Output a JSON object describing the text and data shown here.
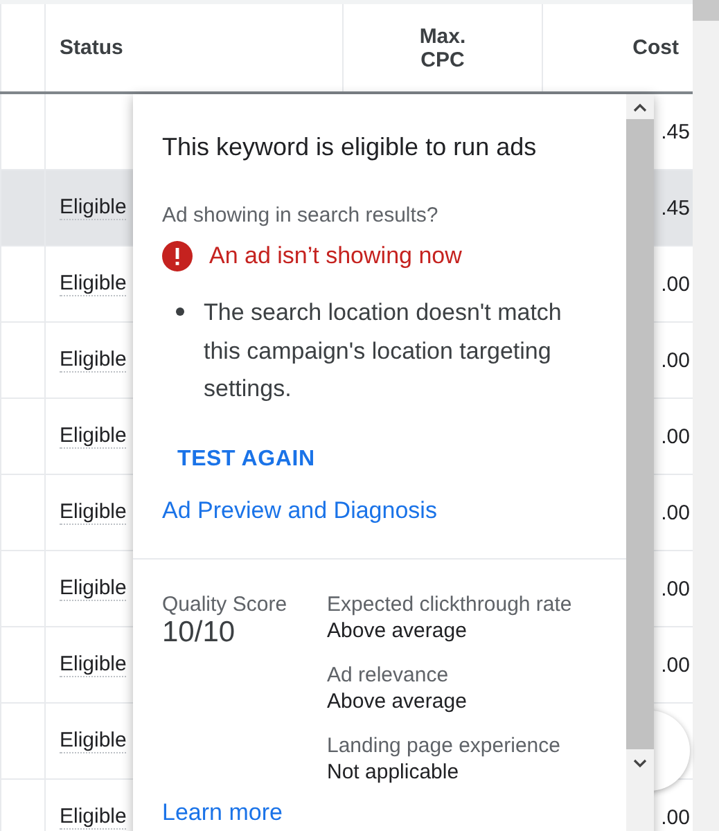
{
  "table": {
    "columns": [
      {
        "label": "Status"
      },
      {
        "label": "Max. CPC"
      },
      {
        "label": "Cost"
      }
    ],
    "rows": [
      {
        "cost": ".45",
        "selected": false
      },
      {
        "status": "Eligible",
        "cost": ".45",
        "selected": true
      },
      {
        "status": "Eligible",
        "cost": ".00",
        "selected": false
      },
      {
        "status": "Eligible",
        "cost": ".00",
        "selected": false
      },
      {
        "status": "Eligible",
        "cost": ".00",
        "selected": false
      },
      {
        "status": "Eligible",
        "cost": ".00",
        "selected": false
      },
      {
        "status": "Eligible",
        "cost": ".00",
        "selected": false
      },
      {
        "status": "Eligible",
        "cost": ".00",
        "selected": false
      },
      {
        "status": "Eligible",
        "selected": false
      },
      {
        "status": "Eligible",
        "cost": ".00",
        "selected": false
      }
    ]
  },
  "popup": {
    "title": "This keyword is eligible to run ads",
    "question": "Ad showing in search results?",
    "alert": "An ad isn’t showing now",
    "reasons": [
      "The search location doesn't match this campaign's location targeting settings."
    ],
    "test_button": "TEST AGAIN",
    "diagnosis_link": "Ad Preview and Diagnosis",
    "quality": {
      "label": "Quality Score",
      "score": "10/10",
      "factors": [
        {
          "label": "Expected clickthrough rate",
          "value": "Above average"
        },
        {
          "label": "Ad relevance",
          "value": "Above average"
        },
        {
          "label": "Landing page experience",
          "value": "Not applicable"
        }
      ]
    },
    "learn_more": "Learn more"
  }
}
